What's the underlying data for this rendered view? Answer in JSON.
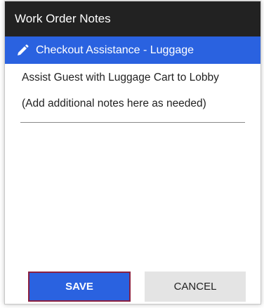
{
  "header": {
    "title": "Work Order Notes"
  },
  "order": {
    "title": "Checkout Assistance - Luggage",
    "icon": "pencil-icon"
  },
  "notes": {
    "line1": "Assist Guest with Luggage Cart to Lobby",
    "line2": "(Add additional notes here as needed)"
  },
  "actions": {
    "save_label": "SAVE",
    "cancel_label": "CANCEL"
  },
  "colors": {
    "header_bg": "#222222",
    "accent": "#2a62e0",
    "save_border": "#8b2040",
    "cancel_bg": "#e4e4e4"
  }
}
